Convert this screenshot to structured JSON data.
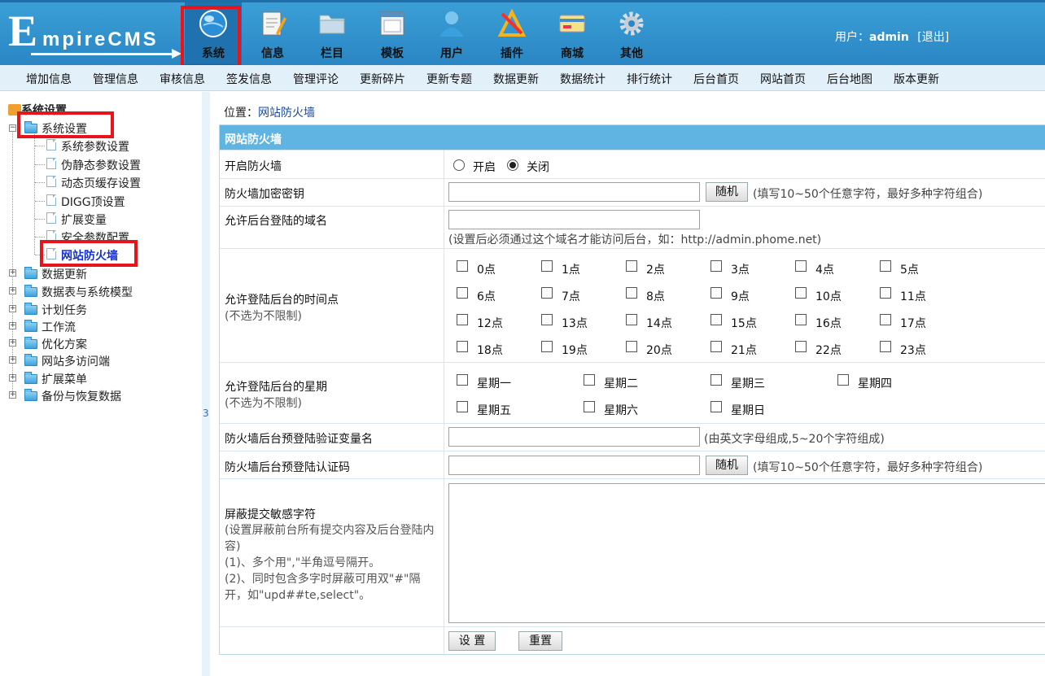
{
  "logo": {
    "first": "E",
    "rest": "mpireCMS"
  },
  "main_nav": [
    {
      "label": "系统",
      "icon": "globe-icon"
    },
    {
      "label": "信息",
      "icon": "notepad-icon"
    },
    {
      "label": "栏目",
      "icon": "folder-icon"
    },
    {
      "label": "模板",
      "icon": "window-icon"
    },
    {
      "label": "用户",
      "icon": "user-icon"
    },
    {
      "label": "插件",
      "icon": "tools-icon"
    },
    {
      "label": "商城",
      "icon": "card-icon"
    },
    {
      "label": "其他",
      "icon": "gear-icon"
    }
  ],
  "user": {
    "prefix": "用户：",
    "name": "admin",
    "logout": "[退出]"
  },
  "sub_nav": [
    "增加信息",
    "管理信息",
    "审核信息",
    "签发信息",
    "管理评论",
    "更新碎片",
    "更新专题",
    "数据更新",
    "数据统计",
    "排行统计",
    "后台首页",
    "网站首页",
    "后台地图",
    "版本更新"
  ],
  "sidebar": {
    "root": "系统设置",
    "group": "系统设置",
    "children": [
      "系统参数设置",
      "伪静态参数设置",
      "动态页缓存设置",
      "DIGG顶设置",
      "扩展变量",
      "安全参数配置",
      "网站防火墙"
    ],
    "folders": [
      "数据更新",
      "数据表与系统模型",
      "计划任务",
      "工作流",
      "优化方案",
      "网站多访问端",
      "扩展菜单",
      "备份与恢复数据"
    ],
    "splitter": "3"
  },
  "breadcrumb": {
    "prefix": "位置：",
    "link": "网站防火墙"
  },
  "form": {
    "title": "网站防火墙",
    "enable_label": "开启防火墙",
    "on": "开启",
    "off": "关闭",
    "key_label": "防火墙加密密钥",
    "random": "随机",
    "key_hint": "(填写10~50个任意字符，最好多种字符组合)",
    "domain_label": "允许后台登陆的域名",
    "domain_hint": "(设置后必须通过这个域名才能访问后台，如：http://admin.phome.net)",
    "hours_label": "允许登陆后台的时间点",
    "nolimit": "(不选为不限制)",
    "hours": [
      "0点",
      "1点",
      "2点",
      "3点",
      "4点",
      "5点",
      "6点",
      "7点",
      "8点",
      "9点",
      "10点",
      "11点",
      "12点",
      "13点",
      "14点",
      "15点",
      "16点",
      "17点",
      "18点",
      "19点",
      "20点",
      "21点",
      "22点",
      "23点"
    ],
    "week_label": "允许登陆后台的星期",
    "weekdays": [
      "星期一",
      "星期二",
      "星期三",
      "星期四",
      "星期五",
      "星期六",
      "星期日"
    ],
    "var_label": "防火墙后台预登陆验证变量名",
    "var_hint": "(由英文字母组成,5~20个字符组成)",
    "code_label": "防火墙后台预登陆认证码",
    "code_hint": "(填写10~50个任意字符，最好多种字符组合)",
    "block_label": "屏蔽提交敏感字符",
    "block_desc1": "(设置屏蔽前台所有提交内容及后台登陆内容)",
    "block_desc2": "(1)、多个用\",\"半角逗号隔开。",
    "block_desc3": "(2)、同时包含多字时屏蔽可用双\"#\"隔开，如\"upd##te,select\"。",
    "submit": "设 置",
    "reset": "重置"
  }
}
